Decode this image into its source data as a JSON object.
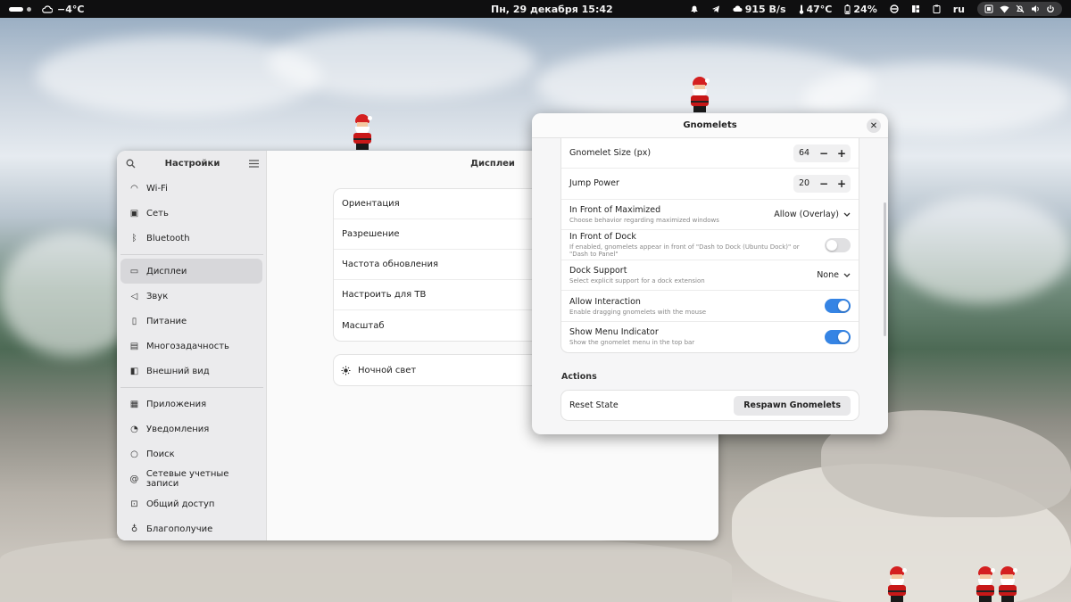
{
  "topbar": {
    "weather_temp": "−4°C",
    "datetime": "Пн, 29 декабря  15:42",
    "net_speed": "915 B/s",
    "cpu_temp": "47°C",
    "battery": "24%",
    "keyboard_layout": "ru"
  },
  "settings": {
    "sidebar_title": "Настройки",
    "main_title": "Дисплеи",
    "sidebar_items_1": [
      {
        "label": "Wi-Fi",
        "icon": "wifi-icon"
      },
      {
        "label": "Сеть",
        "icon": "network-icon"
      },
      {
        "label": "Bluetooth",
        "icon": "bluetooth-icon"
      }
    ],
    "sidebar_items_2": [
      {
        "label": "Дисплеи",
        "icon": "display-icon",
        "active": true
      },
      {
        "label": "Звук",
        "icon": "sound-icon"
      },
      {
        "label": "Питание",
        "icon": "power-icon"
      },
      {
        "label": "Многозадачность",
        "icon": "multitasking-icon"
      },
      {
        "label": "Внешний вид",
        "icon": "appearance-icon"
      }
    ],
    "sidebar_items_3": [
      {
        "label": "Приложения",
        "icon": "apps-icon"
      },
      {
        "label": "Уведомления",
        "icon": "bell-icon"
      },
      {
        "label": "Поиск",
        "icon": "search-icon"
      },
      {
        "label": "Сетевые учетные записи",
        "icon": "online-accounts-icon"
      },
      {
        "label": "Общий доступ",
        "icon": "sharing-icon"
      },
      {
        "label": "Благополучие",
        "icon": "wellbeing-icon"
      }
    ],
    "display_rows": [
      "Ориентация",
      "Разрешение",
      "Частота обновления",
      "Настроить для ТВ",
      "Масштаб"
    ],
    "night_light": "Ночной свет"
  },
  "gnomelets": {
    "title": "Gnomelets",
    "size_label": "Gnomelet Size (px)",
    "size_value": "64",
    "jump_label": "Jump Power",
    "jump_value": "20",
    "maximized_label": "In Front of Maximized",
    "maximized_sub": "Choose behavior regarding maximized windows",
    "maximized_value": "Allow (Overlay)",
    "dock_front_label": "In Front of Dock",
    "dock_front_sub": "If enabled, gnomelets appear in front of \"Dash to Dock (Ubuntu Dock)\" or \"Dash to Panel\"",
    "dock_front_on": false,
    "dock_support_label": "Dock Support",
    "dock_support_sub": "Select explicit support for a dock extension",
    "dock_support_value": "None",
    "interaction_label": "Allow Interaction",
    "interaction_sub": "Enable dragging gnomelets with the mouse",
    "interaction_on": true,
    "menu_indicator_label": "Show Menu Indicator",
    "menu_indicator_sub": "Show the gnomelet menu in the top bar",
    "menu_indicator_on": true,
    "actions_title": "Actions",
    "reset_label": "Reset State",
    "respawn_label": "Respawn Gnomelets"
  }
}
